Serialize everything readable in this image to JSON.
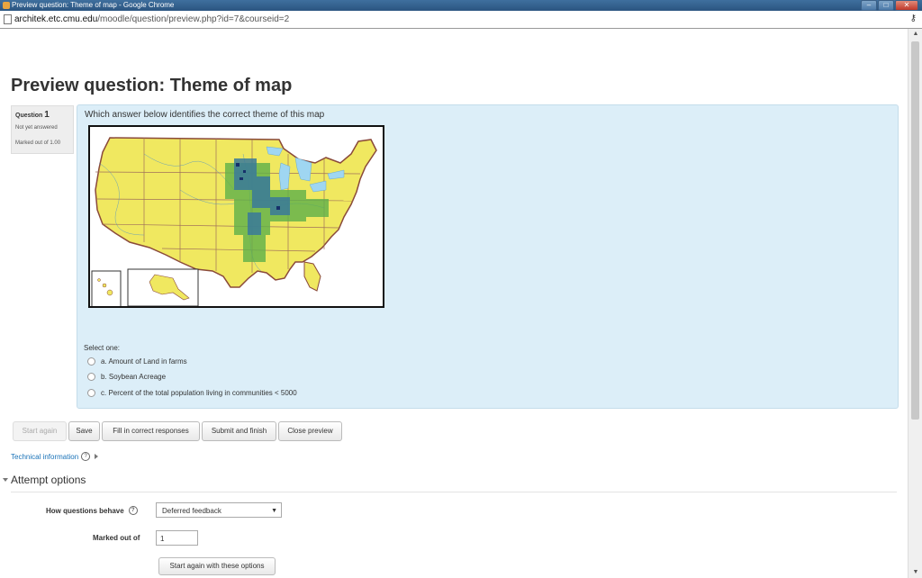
{
  "window": {
    "title": "Preview question: Theme of map - Google Chrome",
    "url_host": "architek.etc.cmu.edu",
    "url_path": "/moodle/question/preview.php?id=7&courseid=2"
  },
  "page": {
    "title": "Preview question: Theme of map"
  },
  "question_info": {
    "label": "Question",
    "number": "1",
    "state": "Not yet answered",
    "marked_out_of": "Marked out of 1.00"
  },
  "question": {
    "text": "Which answer below identifies the correct theme of this map",
    "prompt": "Select one:",
    "answers": [
      {
        "label": "a. Amount of Land in farms",
        "selected": false
      },
      {
        "label": "b. Soybean Acreage",
        "selected": false
      },
      {
        "label": "c. Percent of the total population living in communities < 5000",
        "selected": false
      }
    ]
  },
  "buttons": {
    "start_again": "Start again",
    "save": "Save",
    "fill_correct": "Fill in correct responses",
    "submit_finish": "Submit and finish",
    "close_preview": "Close preview"
  },
  "technical_information": "Technical information",
  "attempt_options": {
    "heading": "Attempt options",
    "how_behave_label": "How questions behave",
    "how_behave_value": "Deferred feedback",
    "marked_out_of_label": "Marked out of",
    "marked_out_of_value": "1",
    "start_again_button": "Start again with these options"
  },
  "colors": {
    "question_bg": "#dceef8",
    "link": "#1a73b8",
    "map_land": "#f0e860",
    "map_water": "#9fd6f2",
    "map_dense": "#3a7a9a",
    "map_green": "#5fb04a"
  }
}
